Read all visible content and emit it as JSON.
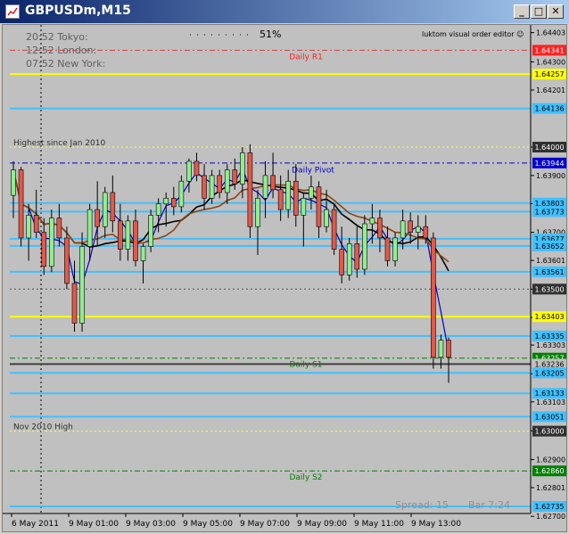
{
  "window": {
    "title": "GBPUSDm,M15",
    "buttons": [
      "_",
      "□",
      "✕"
    ]
  },
  "overlay": {
    "sessions": [
      "20:52 Tokyo:",
      "12:52 London:",
      "07:52 New York:"
    ],
    "candle_progress": "51%",
    "editor_label": "luktom visual order editor ☺",
    "spread": "Spread: 15",
    "bar_timer": "Bar  7:24"
  },
  "colors": {
    "chart_bg": "#c0c0c0",
    "bull": "#90ee90",
    "bear": "#e05a4a",
    "yellow": "#ffff00",
    "sky": "#40c0ff",
    "red_label": "#ff2020",
    "grey_label": "#303030",
    "green_label": "#008000",
    "blue_label": "#00a0ff"
  },
  "chart_data": {
    "type": "candlestick",
    "symbol": "GBPUSDm",
    "timeframe": "M15",
    "ylim": [
      1.6271,
      1.6443
    ],
    "y_ticks": [
      "1.64403",
      "1.64300",
      "1.64201",
      "1.64000",
      "1.63900",
      "1.63801",
      "1.63700",
      "1.63601",
      "1.63500",
      "1.63400",
      "1.63303",
      "1.63202",
      "1.63103",
      "1.63001",
      "1.62900",
      "1.62801",
      "1.62700"
    ],
    "x_ticks": [
      "6 May 2011",
      "9 May 01:00",
      "9 May 03:00",
      "9 May 05:00",
      "9 May 07:00",
      "9 May 09:00",
      "9 May 11:00",
      "9 May 13:00"
    ],
    "horizontal_lines": [
      {
        "price": 1.64341,
        "label": "Daily R1",
        "label_color": "#ff2020",
        "line": "#d04040",
        "style": "dashdot"
      },
      {
        "price": 1.64257,
        "label_color": "#ffff00",
        "line": "#ffff00",
        "style": "solid"
      },
      {
        "price": 1.64136,
        "label_color": "#40c0ff",
        "line": "#40c0ff",
        "style": "solid"
      },
      {
        "price": 1.64,
        "label": "Highest since Jan 2010",
        "label_color": "#303030",
        "line": "#ffff60",
        "style": "dotted"
      },
      {
        "price": 1.63944,
        "label_color": "#0000d0",
        "line": "#0000c0",
        "style": "dashdot"
      },
      {
        "price": 1.63803,
        "label_color": "#40c0ff",
        "line": "#40c0ff",
        "style": "solid"
      },
      {
        "price": 1.63773,
        "label_color": "#40c0ff",
        "line": "#40c0ff",
        "style": "solid"
      },
      {
        "price": 1.63677,
        "label_color": "#40c0ff",
        "line": "#40c0ff",
        "style": "solid"
      },
      {
        "price": 1.63652,
        "label_color": "#40c0ff",
        "line": "#40c0ff",
        "style": "solid"
      },
      {
        "price": 1.63561,
        "label_color": "#40c0ff",
        "line": "#40c0ff",
        "style": "solid"
      },
      {
        "price": 1.635,
        "label_color": "#303030",
        "line": "#505050",
        "style": "dotted"
      },
      {
        "price": 1.63403,
        "label_color": "#ffff00",
        "line": "#ffff00",
        "style": "solid"
      },
      {
        "price": 1.63335,
        "label_color": "#40c0ff",
        "line": "#40c0ff",
        "style": "solid"
      },
      {
        "price": 1.63257,
        "label": "Daily S1",
        "label_color": "#008000",
        "line": "#008000",
        "style": "dashdot"
      },
      {
        "price": 1.63236,
        "label_color": "#c0c0c0",
        "line": "#404040",
        "style": "solid"
      },
      {
        "price": 1.63205,
        "label_color": "#40c0ff",
        "line": "#40c0ff",
        "style": "solid"
      },
      {
        "price": 1.63133,
        "label_color": "#40c0ff",
        "line": "#40c0ff",
        "style": "solid"
      },
      {
        "price": 1.63051,
        "label_color": "#40c0ff",
        "line": "#40c0ff",
        "style": "solid"
      },
      {
        "price": 1.63,
        "label": "Nov 2010 High",
        "label_color": "#303030",
        "line": "#ffff60",
        "style": "dotted"
      },
      {
        "price": 1.6286,
        "label": "Daily S2",
        "label_color": "#008000",
        "line": "#008000",
        "style": "dashdot"
      },
      {
        "price": 1.62735,
        "label_color": "#40c0ff",
        "line": "#40c0ff",
        "style": "solid"
      }
    ],
    "price_labels": [
      "1.64341",
      "1.64257",
      "1.64136",
      "1.64000",
      "1.63944",
      "1.63803",
      "1.63773",
      "1.63677",
      "1.63652",
      "1.63561",
      "1.63500",
      "1.63403",
      "1.63335",
      "1.63257",
      "1.63236",
      "1.63205",
      "1.63133",
      "1.63051",
      "1.63000",
      "1.62860",
      "1.62735"
    ],
    "pivot_label": "Daily Pivot",
    "pivot_price": 1.6392,
    "candles": [
      [
        1.6383,
        1.6395,
        1.6375,
        1.6392
      ],
      [
        1.6392,
        1.6393,
        1.6365,
        1.6368
      ],
      [
        1.6368,
        1.638,
        1.636,
        1.6376
      ],
      [
        1.6376,
        1.6385,
        1.6368,
        1.637
      ],
      [
        1.637,
        1.6375,
        1.6355,
        1.6358
      ],
      [
        1.6358,
        1.6378,
        1.6356,
        1.6375
      ],
      [
        1.6375,
        1.638,
        1.6365,
        1.6368
      ],
      [
        1.6368,
        1.6372,
        1.635,
        1.6352
      ],
      [
        1.6352,
        1.636,
        1.6335,
        1.6338
      ],
      [
        1.6338,
        1.637,
        1.6335,
        1.6365
      ],
      [
        1.6365,
        1.638,
        1.636,
        1.6378
      ],
      [
        1.6378,
        1.6388,
        1.6365,
        1.6372
      ],
      [
        1.6372,
        1.6386,
        1.6368,
        1.6384
      ],
      [
        1.6384,
        1.639,
        1.637,
        1.6374
      ],
      [
        1.6374,
        1.638,
        1.636,
        1.6364
      ],
      [
        1.6364,
        1.6376,
        1.636,
        1.6374
      ],
      [
        1.6374,
        1.6378,
        1.6358,
        1.636
      ],
      [
        1.636,
        1.6366,
        1.6352,
        1.6365
      ],
      [
        1.6365,
        1.6378,
        1.6363,
        1.6376
      ],
      [
        1.6376,
        1.6382,
        1.637,
        1.638
      ],
      [
        1.638,
        1.6384,
        1.6372,
        1.6382
      ],
      [
        1.6382,
        1.6386,
        1.6376,
        1.6379
      ],
      [
        1.6379,
        1.639,
        1.6377,
        1.6388
      ],
      [
        1.6388,
        1.6396,
        1.6384,
        1.6395
      ],
      [
        1.6395,
        1.6398,
        1.6388,
        1.639
      ],
      [
        1.639,
        1.6394,
        1.6378,
        1.6382
      ],
      [
        1.6382,
        1.6392,
        1.638,
        1.639
      ],
      [
        1.639,
        1.6392,
        1.6382,
        1.6384
      ],
      [
        1.6384,
        1.6394,
        1.638,
        1.6392
      ],
      [
        1.6392,
        1.6396,
        1.6385,
        1.6387
      ],
      [
        1.6387,
        1.64,
        1.6382,
        1.6398
      ],
      [
        1.6398,
        1.6401,
        1.6368,
        1.6372
      ],
      [
        1.6372,
        1.6385,
        1.6362,
        1.6382
      ],
      [
        1.6382,
        1.6395,
        1.6375,
        1.639
      ],
      [
        1.639,
        1.6398,
        1.6382,
        1.6385
      ],
      [
        1.6385,
        1.639,
        1.6374,
        1.6378
      ],
      [
        1.6378,
        1.6392,
        1.6375,
        1.6388
      ],
      [
        1.6388,
        1.6394,
        1.6372,
        1.6376
      ],
      [
        1.6376,
        1.6384,
        1.6365,
        1.6382
      ],
      [
        1.6382,
        1.639,
        1.6378,
        1.6386
      ],
      [
        1.6386,
        1.6388,
        1.6368,
        1.6372
      ],
      [
        1.6372,
        1.6385,
        1.637,
        1.6378
      ],
      [
        1.6378,
        1.638,
        1.6362,
        1.6364
      ],
      [
        1.6364,
        1.6372,
        1.6352,
        1.6355
      ],
      [
        1.6355,
        1.6368,
        1.6353,
        1.6366
      ],
      [
        1.6366,
        1.6372,
        1.6354,
        1.6357
      ],
      [
        1.6357,
        1.6376,
        1.6355,
        1.6373
      ],
      [
        1.6373,
        1.638,
        1.6366,
        1.6375
      ],
      [
        1.6375,
        1.6378,
        1.6363,
        1.6368
      ],
      [
        1.6368,
        1.6372,
        1.6358,
        1.636
      ],
      [
        1.636,
        1.637,
        1.6358,
        1.6368
      ],
      [
        1.6368,
        1.6378,
        1.6364,
        1.6374
      ],
      [
        1.6374,
        1.6377,
        1.6366,
        1.637
      ],
      [
        1.637,
        1.6376,
        1.6364,
        1.6372
      ],
      [
        1.6372,
        1.6376,
        1.6366,
        1.6368
      ],
      [
        1.6368,
        1.637,
        1.6322,
        1.6326
      ],
      [
        1.6326,
        1.6334,
        1.6322,
        1.6332
      ],
      [
        1.6332,
        1.6333,
        1.6317,
        1.6326
      ]
    ]
  }
}
